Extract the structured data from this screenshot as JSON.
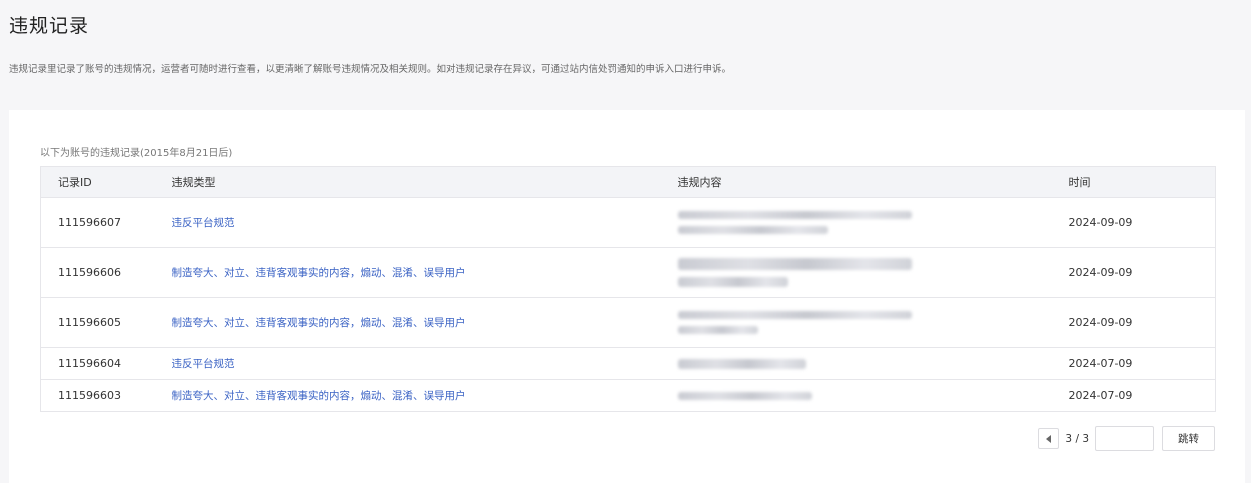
{
  "page": {
    "title": "违规记录",
    "description": "违规记录里记录了账号的违规情况，运营者可随时进行查看，以更清晰了解账号违规情况及相关规则。如对违规记录存在异议，可通过站内信处罚通知的申诉入口进行申诉。"
  },
  "table": {
    "caption": "以下为账号的违规记录(2015年8月21日后)",
    "headers": {
      "id": "记录ID",
      "type": "违规类型",
      "content": "违规内容",
      "time": "时间"
    },
    "rows": [
      {
        "id": "111596607",
        "type": "违反平台规范",
        "time": "2024-09-09"
      },
      {
        "id": "111596606",
        "type": "制造夸大、对立、违背客观事实的内容，煽动、混淆、误导用户",
        "time": "2024-09-09"
      },
      {
        "id": "111596605",
        "type": "制造夸大、对立、违背客观事实的内容，煽动、混淆、误导用户",
        "time": "2024-09-09"
      },
      {
        "id": "111596604",
        "type": "违反平台规范",
        "time": "2024-07-09"
      },
      {
        "id": "111596603",
        "type": "制造夸大、对立、违背客观事实的内容，煽动、混淆、误导用户",
        "time": "2024-07-09"
      }
    ]
  },
  "pagination": {
    "info": "3 / 3",
    "input_value": "",
    "go_label": "跳转",
    "prev_icon": "caret-left-icon"
  }
}
